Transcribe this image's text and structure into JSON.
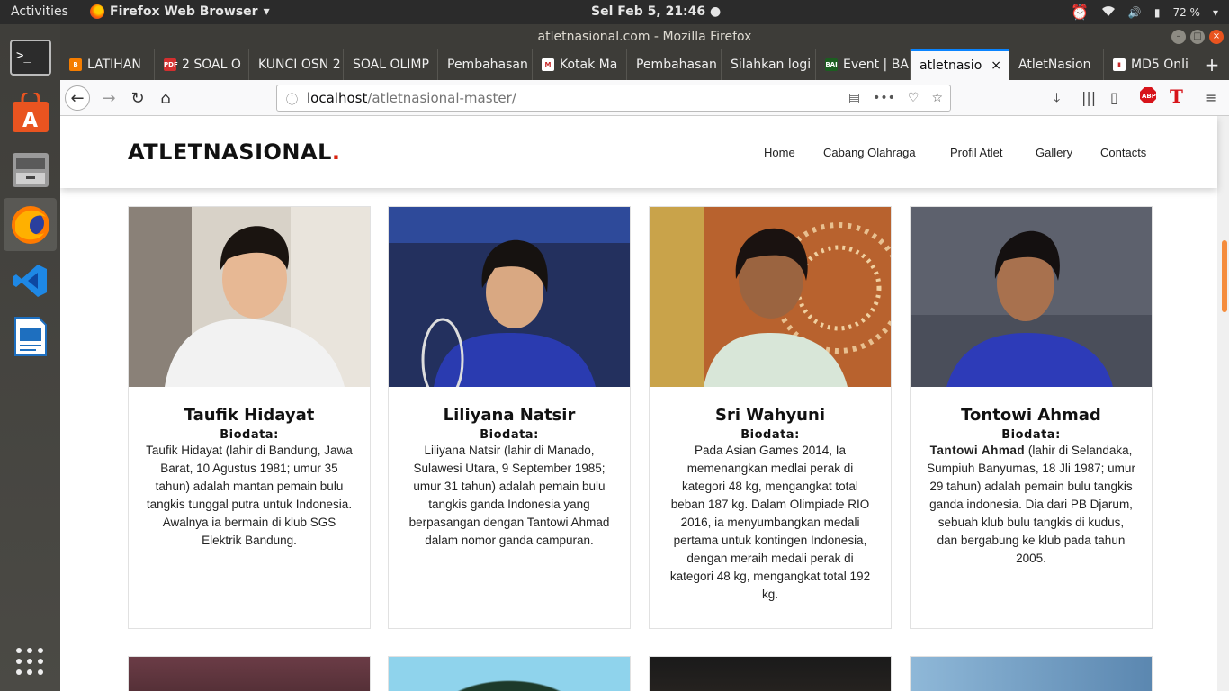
{
  "topbar": {
    "activities": "Activities",
    "app_name": "Firefox Web Browser",
    "clock": "Sel Feb  5, 21:46 ●",
    "battery": "72 %"
  },
  "window": {
    "title": "atletnasional.com - Mozilla Firefox"
  },
  "tabs": [
    {
      "label": "LATIHAN",
      "favicon": "blogger-icon",
      "color": "#f57d00",
      "glyph": "B"
    },
    {
      "label": "2 SOAL O",
      "favicon": "pdf-icon",
      "color": "#d32f2f",
      "glyph": "PDF"
    },
    {
      "label": "KUNCI OSN 2",
      "favicon": "",
      "color": "",
      "glyph": ""
    },
    {
      "label": "SOAL OLIMP",
      "favicon": "",
      "color": "",
      "glyph": ""
    },
    {
      "label": "Pembahasan",
      "favicon": "",
      "color": "",
      "glyph": ""
    },
    {
      "label": "Kotak Ma",
      "favicon": "gmail-icon",
      "color": "#ffffff",
      "glyph": "M"
    },
    {
      "label": "Pembahasan",
      "favicon": "",
      "color": "",
      "glyph": ""
    },
    {
      "label": "Silahkan logi",
      "favicon": "",
      "color": "",
      "glyph": ""
    },
    {
      "label": "Event | BA",
      "favicon": "bai-icon",
      "color": "#1b5e20",
      "glyph": "BAI"
    },
    {
      "label": "atletnasio",
      "favicon": "",
      "color": "",
      "glyph": ""
    },
    {
      "label": "AtletNasion",
      "favicon": "",
      "color": "",
      "glyph": ""
    },
    {
      "label": "MD5 Onli",
      "favicon": "lock-icon",
      "color": "#ffffff",
      "glyph": "▮"
    }
  ],
  "url": {
    "host": "localhost",
    "path": "/atletnasional-master/"
  },
  "site": {
    "brand": "ATLETNASIONAL",
    "brand_dot": ".",
    "nav": [
      "Home",
      "Cabang Olahraga",
      "Profil Atlet",
      "Gallery",
      "Contacts"
    ]
  },
  "athletes": [
    {
      "name": "Taufik Hidayat",
      "bio_label": "Biodata:",
      "bio": "Taufik Hidayat (lahir di Bandung, Jawa Barat, 10 Agustus 1981; umur 35 tahun) adalah mantan pemain bulu tangkis tunggal putra untuk Indonesia. Awalnya ia bermain di klub SGS Elektrik Bandung."
    },
    {
      "name": "Liliyana Natsir",
      "bio_label": "Biodata:",
      "bio": "Liliyana Natsir (lahir di Manado, Sulawesi Utara, 9 September 1985; umur 31 tahun) adalah pemain bulu tangkis ganda Indonesia yang berpasangan dengan Tantowi Ahmad dalam nomor ganda campuran."
    },
    {
      "name": "Sri Wahyuni",
      "bio_label": "Biodata:",
      "bio": "Pada Asian Games 2014, Ia memenangkan medlai perak di kategori 48 kg, mengangkat total beban 187 kg. Dalam Olimpiade RIO 2016, ia menyumbangkan medali pertama untuk kontingen Indonesia, dengan meraih medali perak di kategori 48 kg, mengangkat total 192 kg."
    },
    {
      "name": "Tontowi Ahmad",
      "bio_label": "Biodata:",
      "bio_bold": "Tantowi Ahmad",
      "bio": " (lahir di Selandaka, Sumpiuh Banyumas, 18 Jli 1987; umur 29 tahun) adalah pemain bulu tangkis ganda indonesia. Dia dari PB Djarum, sebuah klub bulu tangkis di kudus, dan bergabung ke klub pada tahun 2005."
    }
  ]
}
